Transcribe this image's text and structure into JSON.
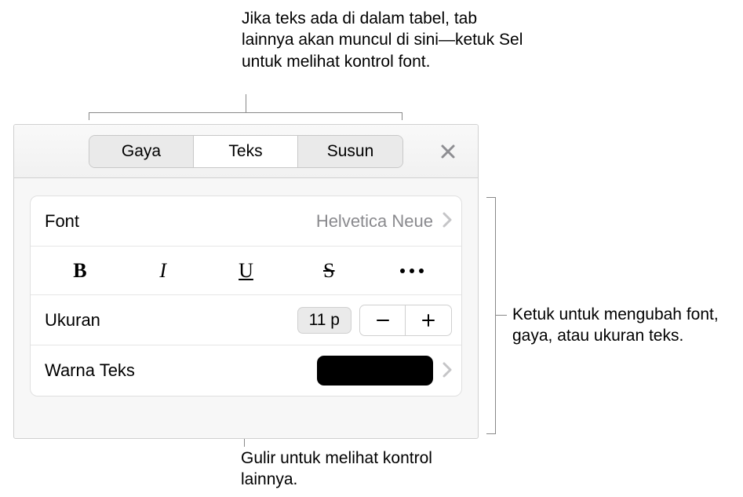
{
  "callouts": {
    "top": "Jika teks ada di dalam tabel, tab lainnya akan muncul di sini—ketuk Sel untuk melihat kontrol font.",
    "right": "Ketuk untuk mengubah font, gaya, atau ukuran teks.",
    "bottom": "Gulir untuk melihat kontrol lainnya."
  },
  "tabs": {
    "style": "Gaya",
    "text": "Teks",
    "arrange": "Susun"
  },
  "rows": {
    "font_label": "Font",
    "font_value": "Helvetica Neue",
    "size_label": "Ukuran",
    "size_value": "11 p",
    "color_label": "Warna Teks"
  },
  "format": {
    "bold": "B",
    "italic": "I",
    "underline": "U",
    "strike": "S"
  },
  "colors": {
    "swatch": "#000000"
  }
}
